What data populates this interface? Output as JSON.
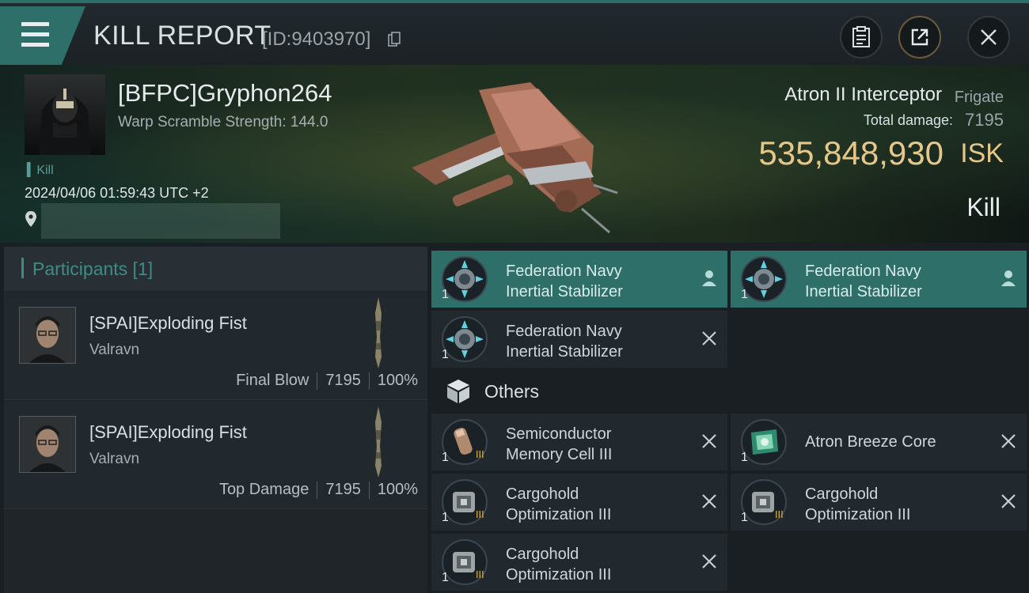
{
  "header": {
    "title": "KILL REPORT",
    "report_id": "[ID:9403970]",
    "icons": [
      "menu-icon",
      "copy-icon",
      "clipboard-icon",
      "share-icon",
      "close-icon"
    ]
  },
  "victim": {
    "pilot_name": "[BFPC]Gryphon264",
    "warp_scramble": "Warp Scramble Strength: 144.0",
    "kill_tag": "Kill",
    "datetime": "2024/04/06 01:59:43 UTC +2"
  },
  "ship": {
    "name": "Atron II Interceptor",
    "class": "Frigate",
    "total_damage_label": "Total damage:",
    "total_damage": "7195",
    "isk_value": "535,848,930",
    "isk_unit": "ISK",
    "result": "Kill"
  },
  "participants": {
    "label": "Participants [1]",
    "rows": [
      {
        "name": "[SPAI]Exploding Fist",
        "corp": "Valravn",
        "role": "Final Blow",
        "damage": "7195",
        "percent": "100%"
      },
      {
        "name": "[SPAI]Exploding Fist",
        "corp": "Valravn",
        "role": "Top Damage",
        "damage": "7195",
        "percent": "100%"
      }
    ]
  },
  "modules": [
    {
      "line1": "Federation Navy",
      "line2": "Inertial Stabilizer",
      "qty": "1",
      "status": "dropped"
    },
    {
      "line1": "Federation Navy",
      "line2": "Inertial Stabilizer",
      "qty": "1",
      "status": "dropped"
    },
    {
      "line1": "Federation Navy",
      "line2": "Inertial Stabilizer",
      "qty": "1",
      "status": "destroyed"
    }
  ],
  "others": {
    "label": "Others",
    "items": [
      {
        "line1": "Semiconductor",
        "line2": "Memory Cell III",
        "qty": "1",
        "status": "destroyed"
      },
      {
        "line1": "Atron Breeze Core",
        "line2": "",
        "qty": "1",
        "status": "destroyed"
      },
      {
        "line1": "Cargohold",
        "line2": "Optimization III",
        "qty": "1",
        "status": "destroyed"
      },
      {
        "line1": "Cargohold",
        "line2": "Optimization III",
        "qty": "1",
        "status": "destroyed"
      },
      {
        "line1": "Cargohold",
        "line2": "Optimization III",
        "qty": "1",
        "status": "destroyed"
      }
    ]
  },
  "colors": {
    "accent": "#2f6f6a",
    "isk": "#e6c78a",
    "panel": "#22292e"
  }
}
